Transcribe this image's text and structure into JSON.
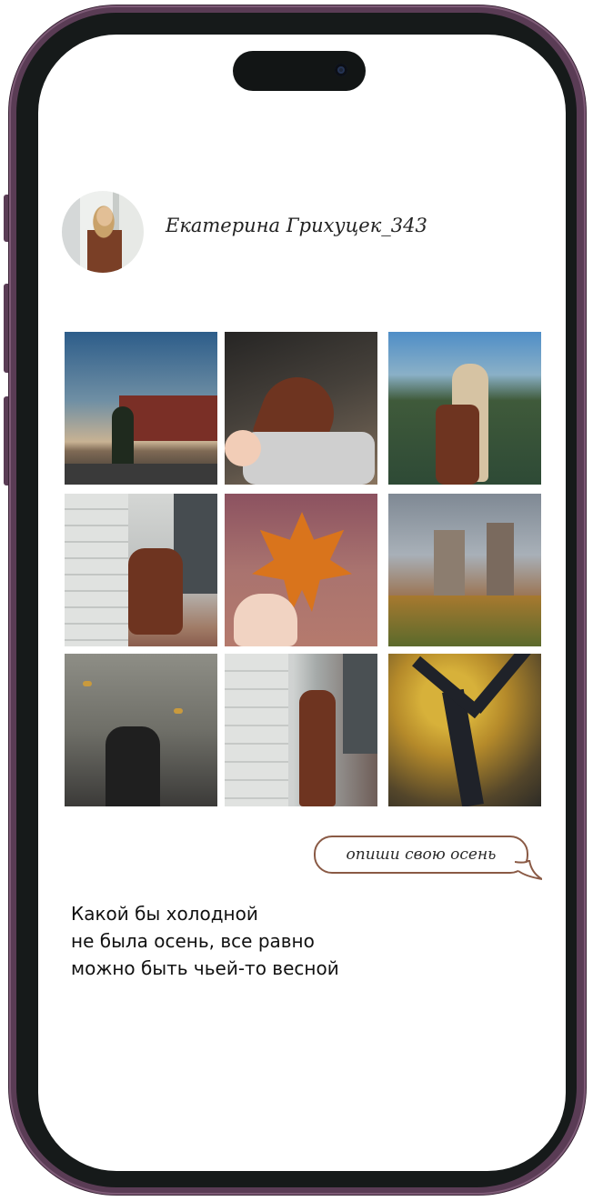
{
  "profile": {
    "username": "Екатерина Грихуцек_343"
  },
  "prompt": {
    "bubble_text": "опиши свою осень"
  },
  "caption": {
    "lines": [
      "Какой бы холодной",
      "не была осень, все равно",
      "можно быть чьей-то весной"
    ]
  },
  "icons": {
    "camera": "front-camera-icon"
  },
  "colors": {
    "frame": "#5a3c55",
    "bezel": "#161a1a",
    "bubble_border": "#8a5a45"
  }
}
